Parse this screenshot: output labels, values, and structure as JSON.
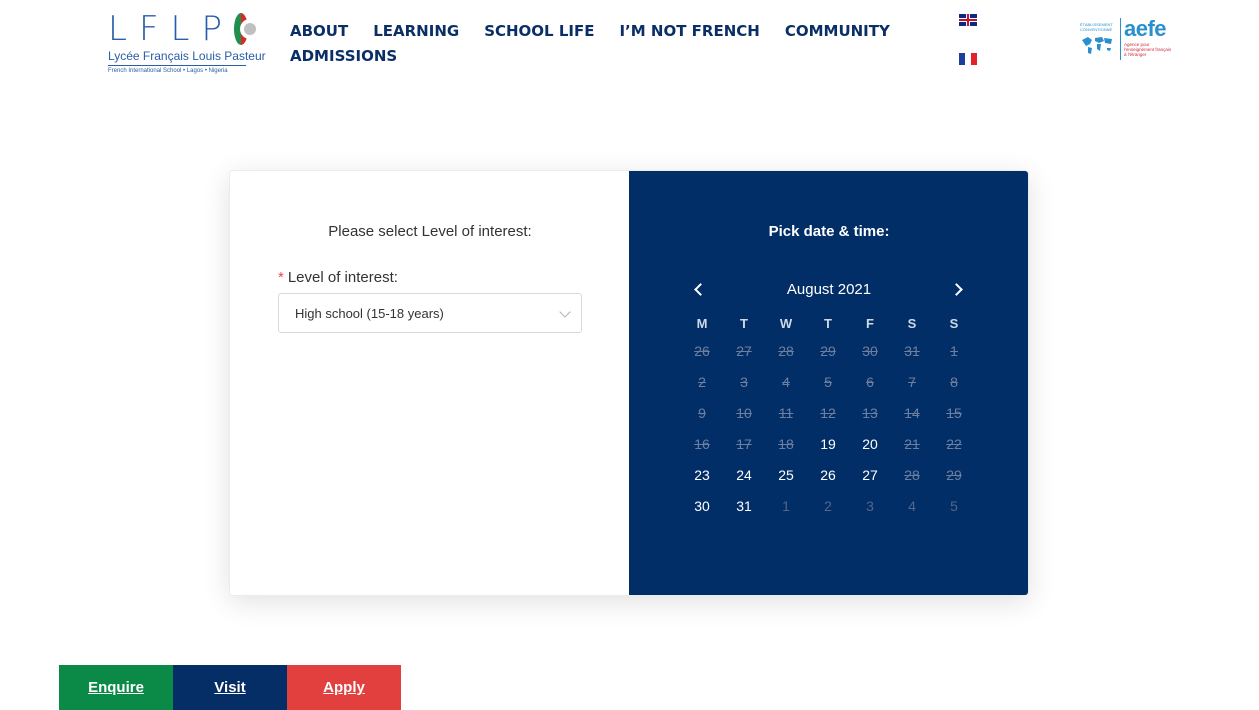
{
  "brand": {
    "logo_letters": [
      "L",
      "F",
      "L",
      "P"
    ],
    "name": "Lycée Français Louis Pasteur",
    "tagline": "French International School • Lagos • Nigeria",
    "colors": {
      "primary": "#2a5ea8",
      "red": "#d62b2b",
      "green": "#1f8f4e"
    }
  },
  "nav": {
    "items": [
      "ABOUT",
      "LEARNING",
      "SCHOOL LIFE",
      "I’M NOT FRENCH",
      "COMMUNITY",
      "ADMISSIONS"
    ]
  },
  "languages": [
    {
      "code": "en",
      "icon": "uk-flag-icon"
    },
    {
      "code": "fr",
      "icon": "france-flag-icon"
    }
  ],
  "partner": {
    "name": "aefe",
    "small_text": "ÉTABLISSEMENT CONVENTIONNÉ",
    "description": "Agence pour l'enseignement français à l'étranger"
  },
  "form": {
    "title": "Please select Level of interest:",
    "field_label": "Level of interest:",
    "required_mark": "*",
    "selected_value": "High school (15-18 years)"
  },
  "calendar": {
    "title": "Pick date & time:",
    "month_label": "August 2021",
    "weekdays": [
      "M",
      "T",
      "W",
      "T",
      "F",
      "S",
      "S"
    ],
    "weeks": [
      [
        {
          "d": "26",
          "s": "struck"
        },
        {
          "d": "27",
          "s": "struck"
        },
        {
          "d": "28",
          "s": "struck"
        },
        {
          "d": "29",
          "s": "struck"
        },
        {
          "d": "30",
          "s": "struck"
        },
        {
          "d": "31",
          "s": "struck"
        },
        {
          "d": "1",
          "s": "struck"
        }
      ],
      [
        {
          "d": "2",
          "s": "struck"
        },
        {
          "d": "3",
          "s": "struck"
        },
        {
          "d": "4",
          "s": "struck"
        },
        {
          "d": "5",
          "s": "struck"
        },
        {
          "d": "6",
          "s": "struck"
        },
        {
          "d": "7",
          "s": "struck"
        },
        {
          "d": "8",
          "s": "struck"
        }
      ],
      [
        {
          "d": "9",
          "s": "struck"
        },
        {
          "d": "10",
          "s": "struck"
        },
        {
          "d": "11",
          "s": "struck"
        },
        {
          "d": "12",
          "s": "struck"
        },
        {
          "d": "13",
          "s": "struck"
        },
        {
          "d": "14",
          "s": "struck"
        },
        {
          "d": "15",
          "s": "struck"
        }
      ],
      [
        {
          "d": "16",
          "s": "struck"
        },
        {
          "d": "17",
          "s": "struck"
        },
        {
          "d": "18",
          "s": "struck"
        },
        {
          "d": "19",
          "s": "avail"
        },
        {
          "d": "20",
          "s": "avail"
        },
        {
          "d": "21",
          "s": "struck"
        },
        {
          "d": "22",
          "s": "struck"
        }
      ],
      [
        {
          "d": "23",
          "s": "avail"
        },
        {
          "d": "24",
          "s": "avail"
        },
        {
          "d": "25",
          "s": "avail"
        },
        {
          "d": "26",
          "s": "avail"
        },
        {
          "d": "27",
          "s": "avail"
        },
        {
          "d": "28",
          "s": "struck"
        },
        {
          "d": "29",
          "s": "struck"
        }
      ],
      [
        {
          "d": "30",
          "s": "avail"
        },
        {
          "d": "31",
          "s": "avail"
        },
        {
          "d": "1",
          "s": "other"
        },
        {
          "d": "2",
          "s": "other"
        },
        {
          "d": "3",
          "s": "other"
        },
        {
          "d": "4",
          "s": "other"
        },
        {
          "d": "5",
          "s": "other"
        }
      ]
    ],
    "colors": {
      "background": "#022e68",
      "available": "#ffffff",
      "unavailable": "#6d7f9e"
    }
  },
  "cta": {
    "enquire": "Enquire",
    "visit": "Visit",
    "apply": "Apply",
    "colors": {
      "enquire": "#0b8a47",
      "visit": "#062e66",
      "apply": "#e2403f"
    }
  }
}
